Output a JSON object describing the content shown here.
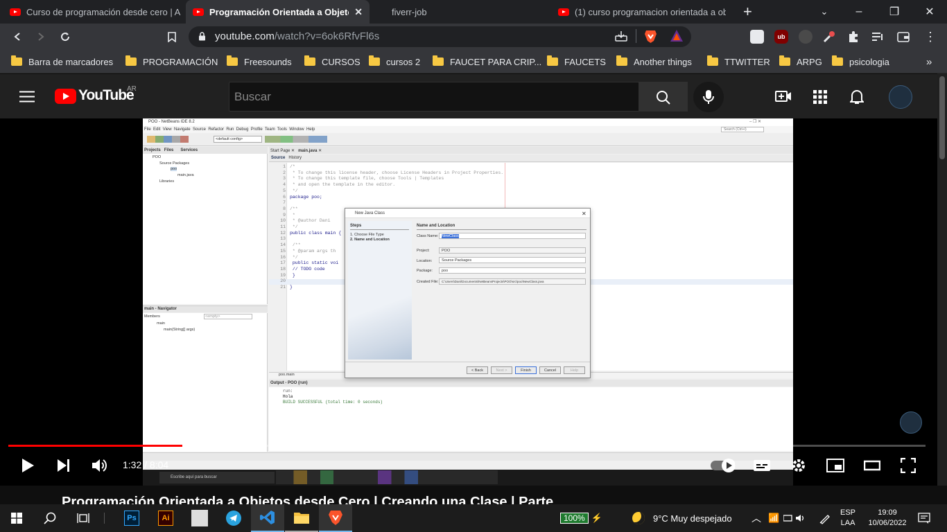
{
  "browser": {
    "tabs": [
      {
        "label": "Curso de programación desde cero | A"
      },
      {
        "label": "Programación Orientada a Objeto"
      },
      {
        "label": "fiverr-job"
      },
      {
        "label": "(1) curso programacion orientada a ob"
      }
    ],
    "url_host": "youtube.com",
    "url_path": "/watch?v=6ok6RfvFl6s",
    "bookmarks": [
      "Barra de marcadores",
      "PROGRAMACIÓN",
      "Freesounds",
      "CURSOS",
      "cursos 2",
      "FAUCET PARA CRIP...",
      "FAUCETS",
      "Another things",
      "TTWITTER",
      "ARPG",
      "psicologia"
    ],
    "bookmarks_more": "»"
  },
  "youtube": {
    "logo_text": "YouTube",
    "country": "AR",
    "search_placeholder": "Buscar",
    "player": {
      "time": "1:32 / 8:04",
      "progress_fraction": 0.19,
      "buffer_fraction": 0.24
    },
    "video_title": "Programación Orientada a Objetos desde Cero | Creando una Clase | Parte"
  },
  "netbeans": {
    "title": "POO - NetBeans IDE 8.2",
    "menu": [
      "File",
      "Edit",
      "View",
      "Navigate",
      "Source",
      "Refactor",
      "Run",
      "Debug",
      "Profile",
      "Team",
      "Tools",
      "Window",
      "Help"
    ],
    "config": "<default config>",
    "search": "Search (Ctrl+I)",
    "project_tabs": [
      "Projects",
      "Files",
      "Services"
    ],
    "tree": [
      "POO",
      "Source Packages",
      "poo",
      "main.java",
      "Libraries"
    ],
    "editor_tabs": [
      "Start Page",
      "main.java"
    ],
    "editor_subtabs": [
      "Source",
      "History"
    ],
    "code_lines": [
      "/*",
      " * To change this license header, choose License Headers in Project Properties.",
      " * To change this template file, choose Tools | Templates",
      " * and open the template in the editor.",
      " */",
      "package poo;",
      "",
      "/**",
      " *",
      " * @author Dani",
      " */",
      "public class main {",
      "",
      "    /**",
      "     * @param args th",
      "     */",
      "    public static voi",
      "        // TODO code",
      "    }",
      "",
      "}"
    ],
    "navigator_title": "main - Navigator",
    "navigator_members": "Members",
    "navigator_empty": "<empty>",
    "navigator_items": [
      "main",
      "main(String[] args)"
    ],
    "breadcrumb": "poo.main",
    "output_title": "Output - POO (run)",
    "output_lines": [
      "run:",
      "Hola",
      "BUILD SUCCESSFUL (total time: 0 seconds)"
    ],
    "taskbar_search": "Escribe aquí para buscar",
    "dialog": {
      "title": "New Java Class",
      "steps_title": "Steps",
      "steps": [
        "1.   Choose File Type",
        "2.   Name and Location"
      ],
      "section": "Name and Location",
      "class_name_label": "Class Name:",
      "class_name_value": "NewClass",
      "project_label": "Project:",
      "project_value": "POO",
      "location_label": "Location:",
      "location_value": "Source Packages",
      "package_label": "Package:",
      "package_value": "poo",
      "created_label": "Created File:",
      "created_value": "C:\\Users\\Dani\\Documents\\NetBeansProjects\\POO\\src\\poo\\NewClass.java",
      "buttons": [
        "< Back",
        "Next >",
        "Finish",
        "Cancel",
        "Help"
      ]
    }
  },
  "taskbar": {
    "battery": "100%",
    "weather": "9°C  Muy despejado",
    "lang_top": "ESP",
    "lang_bottom": "LAA",
    "time": "19:09",
    "date": "10/06/2022"
  }
}
